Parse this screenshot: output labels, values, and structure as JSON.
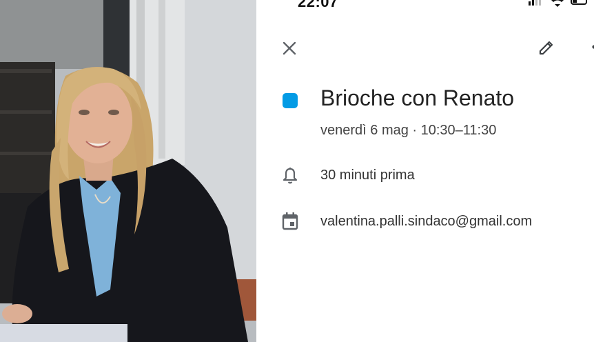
{
  "status_bar": {
    "time": "22:07"
  },
  "photo": {
    "description_icon": "portrait-photo"
  },
  "toolbar": {
    "close_icon": "close-icon",
    "edit_icon": "pencil-icon",
    "more_icon": "more-vert-icon"
  },
  "event": {
    "color": "#039be5",
    "title": "Brioche con Renato",
    "when": "venerdì 6 mag · 10:30–11:30",
    "reminder": "30 minuti prima",
    "calendar": "valentina.palli.sindaco@gmail.com"
  }
}
